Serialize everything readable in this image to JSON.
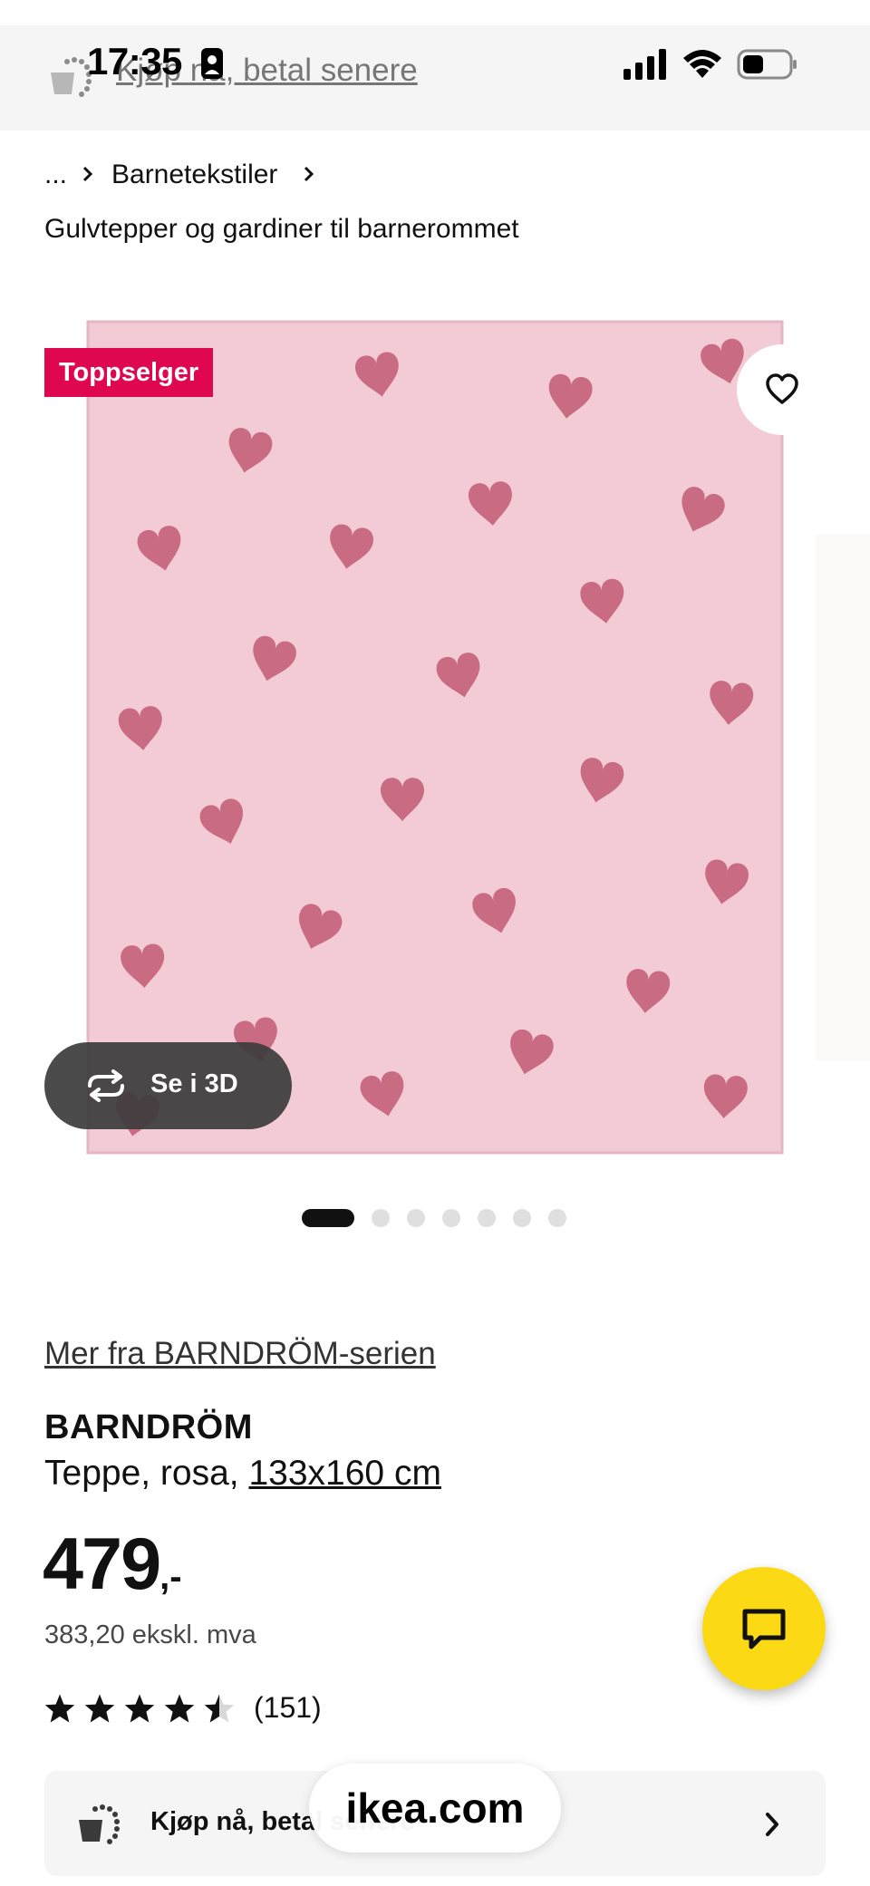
{
  "status_bar": {
    "time": "17:35"
  },
  "top_banner": {
    "text": "Kjøp nå, betal senere"
  },
  "breadcrumb": {
    "ellipsis": "...",
    "category": "Barnetekstiler"
  },
  "sub_heading": "Gulvtepper og gardiner til barnerommet",
  "product_image": {
    "badge": "Toppselger",
    "view_3d_label": "Se i 3D",
    "colors": {
      "rug": "#f3cbd5",
      "heart": "#c96b82",
      "badge": "#e00751"
    }
  },
  "carousel": {
    "count": 7,
    "active_index": 0
  },
  "product": {
    "series_link": "Mer fra BARNDRÖM-serien",
    "name": "BARNDRÖM",
    "desc_prefix": "Teppe, rosa, ",
    "size": "133x160 cm",
    "price_integer": "479",
    "price_suffix": ",-",
    "price_ex_vat": "383,20 ekskl. mva",
    "rating": 4.5,
    "review_count": "(151)"
  },
  "chat": {
    "icon": "chat-bubble-icon",
    "color": "#fbd914"
  },
  "bottom_bar": {
    "text": "Kjøp nå, betal senere"
  },
  "url_pill": {
    "text": "ikea.com"
  }
}
